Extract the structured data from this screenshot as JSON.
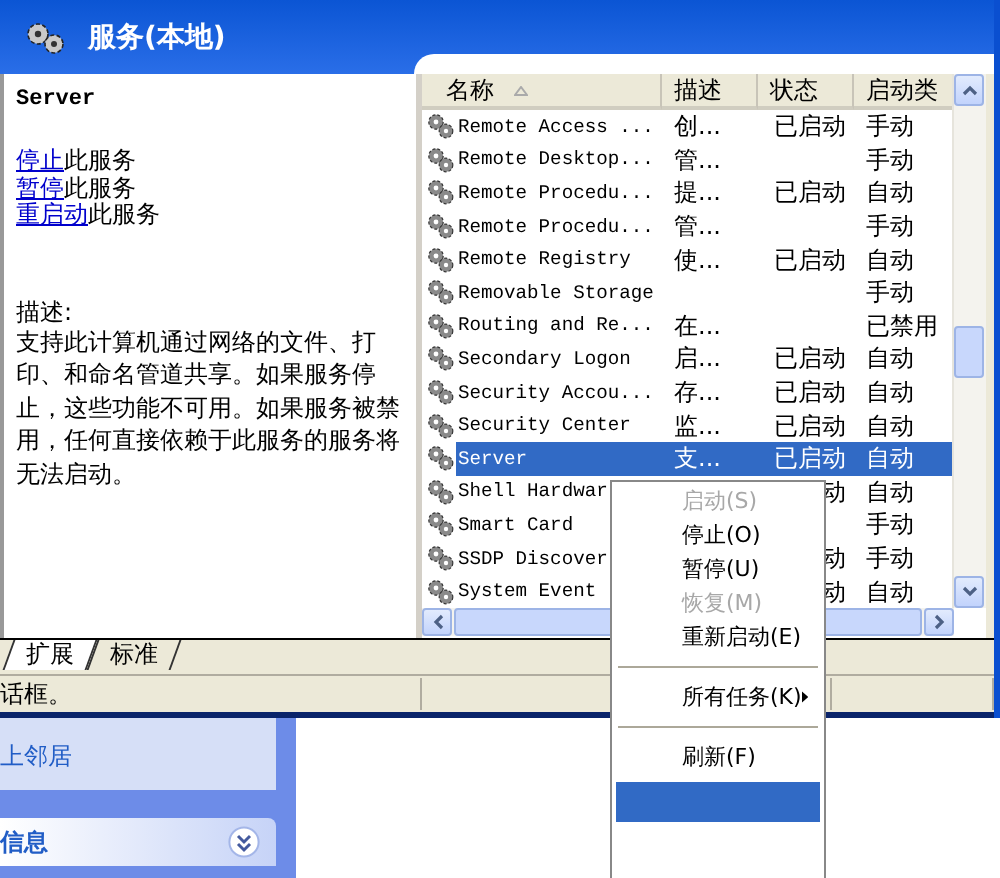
{
  "window": {
    "title": "服务(本地)"
  },
  "detail": {
    "service_name": "Server",
    "actions": [
      {
        "link": "停止",
        "text": "此服务"
      },
      {
        "link": "暂停",
        "text": "此服务"
      },
      {
        "link": "重启动",
        "text": "此服务"
      }
    ],
    "description_label": "描述:",
    "description": "支持此计算机通过网络的文件、打印、和命名管道共享。如果服务停止，这些功能不可用。如果服务被禁用，任何直接依赖于此服务的服务将无法启动。"
  },
  "table": {
    "columns": [
      "名称",
      "描述",
      "状态",
      "启动类"
    ],
    "rows": [
      {
        "name": "Remote Access ...",
        "description": "创...",
        "status": "已启动",
        "startup": "手动",
        "selected": false
      },
      {
        "name": "Remote Desktop...",
        "description": "管...",
        "status": "",
        "startup": "手动",
        "selected": false
      },
      {
        "name": "Remote Procedu...",
        "description": "提...",
        "status": "已启动",
        "startup": "自动",
        "selected": false
      },
      {
        "name": "Remote Procedu...",
        "description": "管...",
        "status": "",
        "startup": "手动",
        "selected": false
      },
      {
        "name": "Remote Registry",
        "description": "使...",
        "status": "已启动",
        "startup": "自动",
        "selected": false
      },
      {
        "name": "Removable Storage",
        "description": "",
        "status": "",
        "startup": "手动",
        "selected": false
      },
      {
        "name": "Routing and Re...",
        "description": "在...",
        "status": "",
        "startup": "已禁用",
        "selected": false
      },
      {
        "name": "Secondary Logon",
        "description": "启...",
        "status": "已启动",
        "startup": "自动",
        "selected": false
      },
      {
        "name": "Security Accou...",
        "description": "存...",
        "status": "已启动",
        "startup": "自动",
        "selected": false
      },
      {
        "name": "Security Center",
        "description": "监...",
        "status": "已启动",
        "startup": "自动",
        "selected": false
      },
      {
        "name": "Server",
        "description": "支...",
        "status": "已启动",
        "startup": "自动",
        "selected": true
      },
      {
        "name": "Shell Hardwar",
        "description": "",
        "status": "动",
        "startup": "自动",
        "selected": false
      },
      {
        "name": "Smart Card",
        "description": "",
        "status": "",
        "startup": "手动",
        "selected": false
      },
      {
        "name": "SSDP Discover",
        "description": "",
        "status": "动",
        "startup": "手动",
        "selected": false
      },
      {
        "name": "System Event",
        "description": "",
        "status": "动",
        "startup": "自动",
        "selected": false
      }
    ]
  },
  "tabs": [
    {
      "label": "扩展",
      "selected": true
    },
    {
      "label": "标准",
      "selected": false
    }
  ],
  "status_bar": "话框。",
  "task_pane": {
    "link": "上邻居",
    "section": "信息"
  },
  "context_menu": [
    {
      "kind": "item",
      "label": "启动(S)",
      "disabled": true,
      "selected": false
    },
    {
      "kind": "item",
      "label": "停止(O)",
      "disabled": false,
      "selected": false
    },
    {
      "kind": "item",
      "label": "暂停(U)",
      "disabled": false,
      "selected": false
    },
    {
      "kind": "item",
      "label": "恢复(M)",
      "disabled": true,
      "selected": false
    },
    {
      "kind": "item",
      "label": "重新启动(E)",
      "disabled": false,
      "selected": false
    },
    {
      "kind": "separator"
    },
    {
      "kind": "submenu",
      "label": "所有任务(K)",
      "disabled": false,
      "selected": false
    },
    {
      "kind": "separator"
    },
    {
      "kind": "item",
      "label": "刷新(F)",
      "disabled": false,
      "selected": false
    },
    {
      "kind": "item",
      "disabled": false,
      "selected": true
    }
  ]
}
